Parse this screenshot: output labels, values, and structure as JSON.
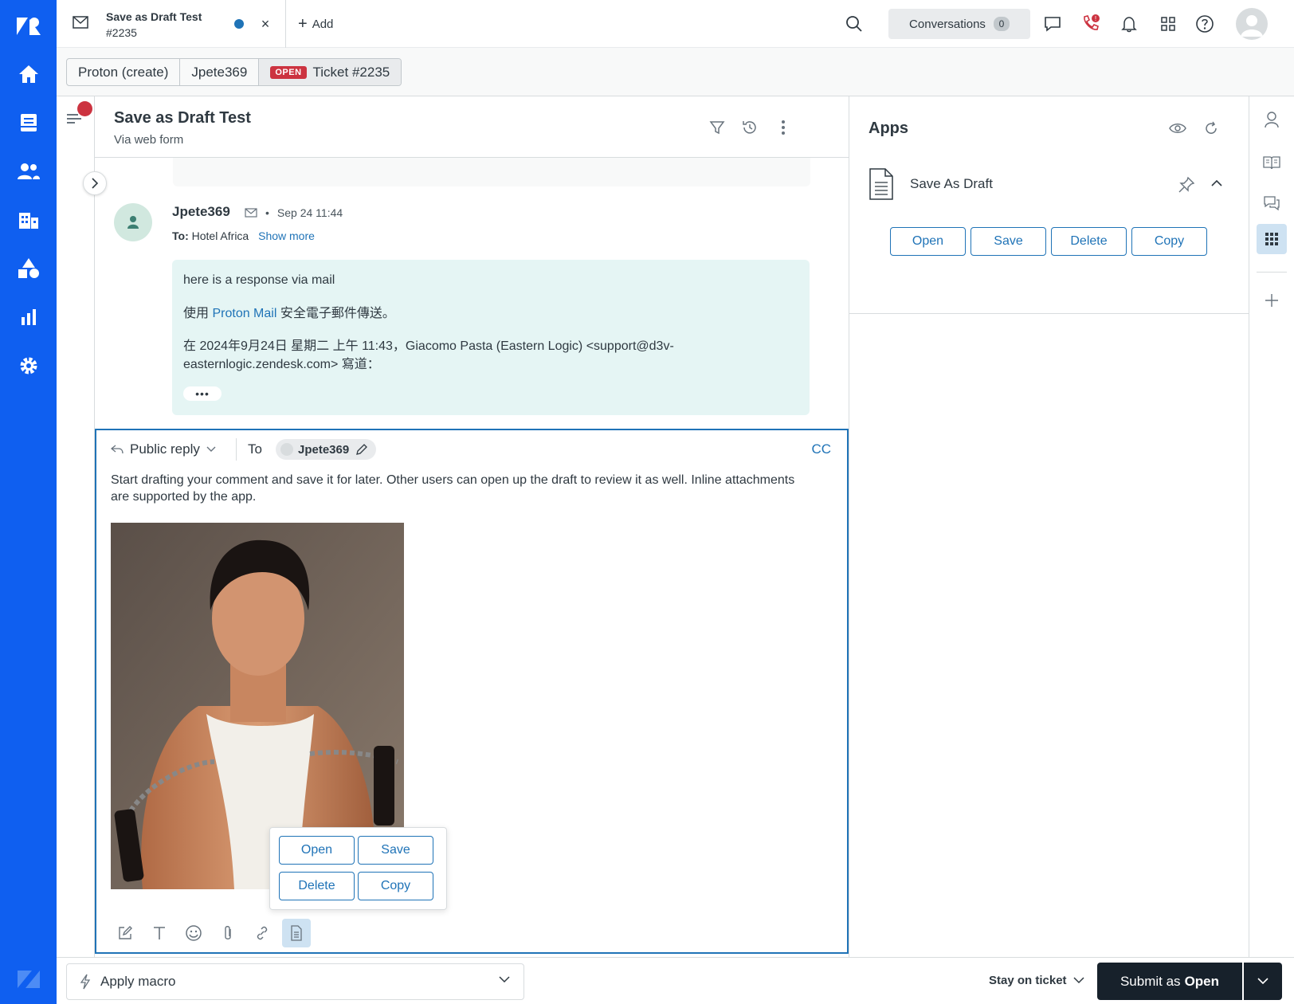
{
  "colors": {
    "nav": "#0f5ff0",
    "accent": "#1f73b7",
    "danger": "#cc3340",
    "bubble": "#e5f5f4",
    "submit": "#17212b"
  },
  "nav_icons": [
    "zendesk-logo-icon",
    "home-icon",
    "views-icon",
    "customers-icon",
    "organizations-icon",
    "objects-icon",
    "reporting-icon",
    "admin-gear-icon",
    "zendesk-product-icon"
  ],
  "top_tab": {
    "title": "Save as Draft Test",
    "number": "#2235",
    "close": "×"
  },
  "topbar": {
    "add_label": "Add",
    "conversations_label": "Conversations",
    "conversations_count": "0"
  },
  "breadcrumbs": {
    "org": "Proton (create)",
    "user": "Jpete369",
    "status_badge": "OPEN",
    "ticket": "Ticket #2235"
  },
  "ticket": {
    "title": "Save as Draft Test",
    "channel": "Via web form"
  },
  "message": {
    "author": "Jpete369",
    "time": "Sep 24 11:44",
    "to_label": "To:",
    "to_value": "Hotel Africa",
    "show_more": "Show more",
    "line1": "here is a response via mail",
    "line2_prefix": "使用",
    "line2_link": "Proton Mail",
    "line2_suffix": "安全電子郵件傳送。",
    "line3": "在 2024年9月24日 星期二 上午 11:43，Giacomo Pasta (Eastern Logic) <support@d3v-easternlogic.zendesk.com> 寫道：",
    "ellipsis": "•••"
  },
  "editor": {
    "reply_type": "Public reply",
    "to_label": "To",
    "recipient": "Jpete369",
    "cc_label": "CC",
    "body": "Start drafting your comment and save it for later.  Other users can open up the draft to review it as well.  Inline attachments are supported by the app.",
    "popup_buttons": {
      "open": "Open",
      "save": "Save",
      "delete": "Delete",
      "copy": "Copy"
    }
  },
  "apps": {
    "title": "Apps",
    "app_name": "Save As Draft",
    "buttons": {
      "open": "Open",
      "save": "Save",
      "delete": "Delete",
      "copy": "Copy"
    }
  },
  "footer": {
    "macro_label": "Apply macro",
    "stay_label": "Stay on ticket",
    "submit_prefix": "Submit as",
    "submit_status": "Open"
  }
}
